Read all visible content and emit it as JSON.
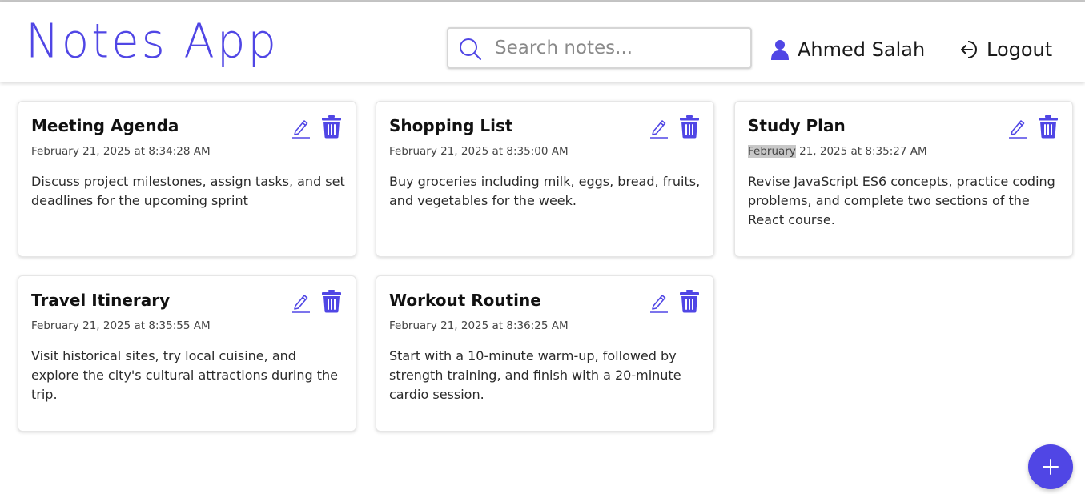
{
  "header": {
    "logo": "Notes App",
    "search_placeholder": "Search notes...",
    "user_name": "Ahmed Salah",
    "logout_label": "Logout"
  },
  "notes": [
    {
      "title": "Meeting Agenda",
      "date": "February 21, 2025 at 8:34:28 AM",
      "body": "Discuss project milestones, assign tasks, and set deadlines for the upcoming sprint"
    },
    {
      "title": "Shopping List",
      "date": "February 21, 2025 at 8:35:00 AM",
      "body": "Buy groceries including milk, eggs, bread, fruits, and vegetables for the week."
    },
    {
      "title": "Study Plan",
      "date_highlight": "February",
      "date_rest": " 21, 2025 at 8:35:27 AM",
      "body": "Revise JavaScript ES6 concepts, practice coding problems, and complete two sections of the React course."
    },
    {
      "title": "Travel Itinerary",
      "date": "February 21, 2025 at 8:35:55 AM",
      "body": "Visit historical sites, try local cuisine, and explore the city's cultural attractions during the trip."
    },
    {
      "title": "Workout Routine",
      "date": "February 21, 2025 at 8:36:25 AM",
      "body": "Start with a 10-minute warm-up, followed by strength training, and finish with a 20-minute cardio session."
    }
  ],
  "colors": {
    "accent": "#5046e5",
    "text": "#111111",
    "muted": "#444444"
  },
  "icons": {
    "search": "search-icon",
    "user": "user-icon",
    "logout": "logout-icon",
    "edit": "pencil-icon",
    "delete": "trash-icon",
    "add": "plus-icon"
  }
}
